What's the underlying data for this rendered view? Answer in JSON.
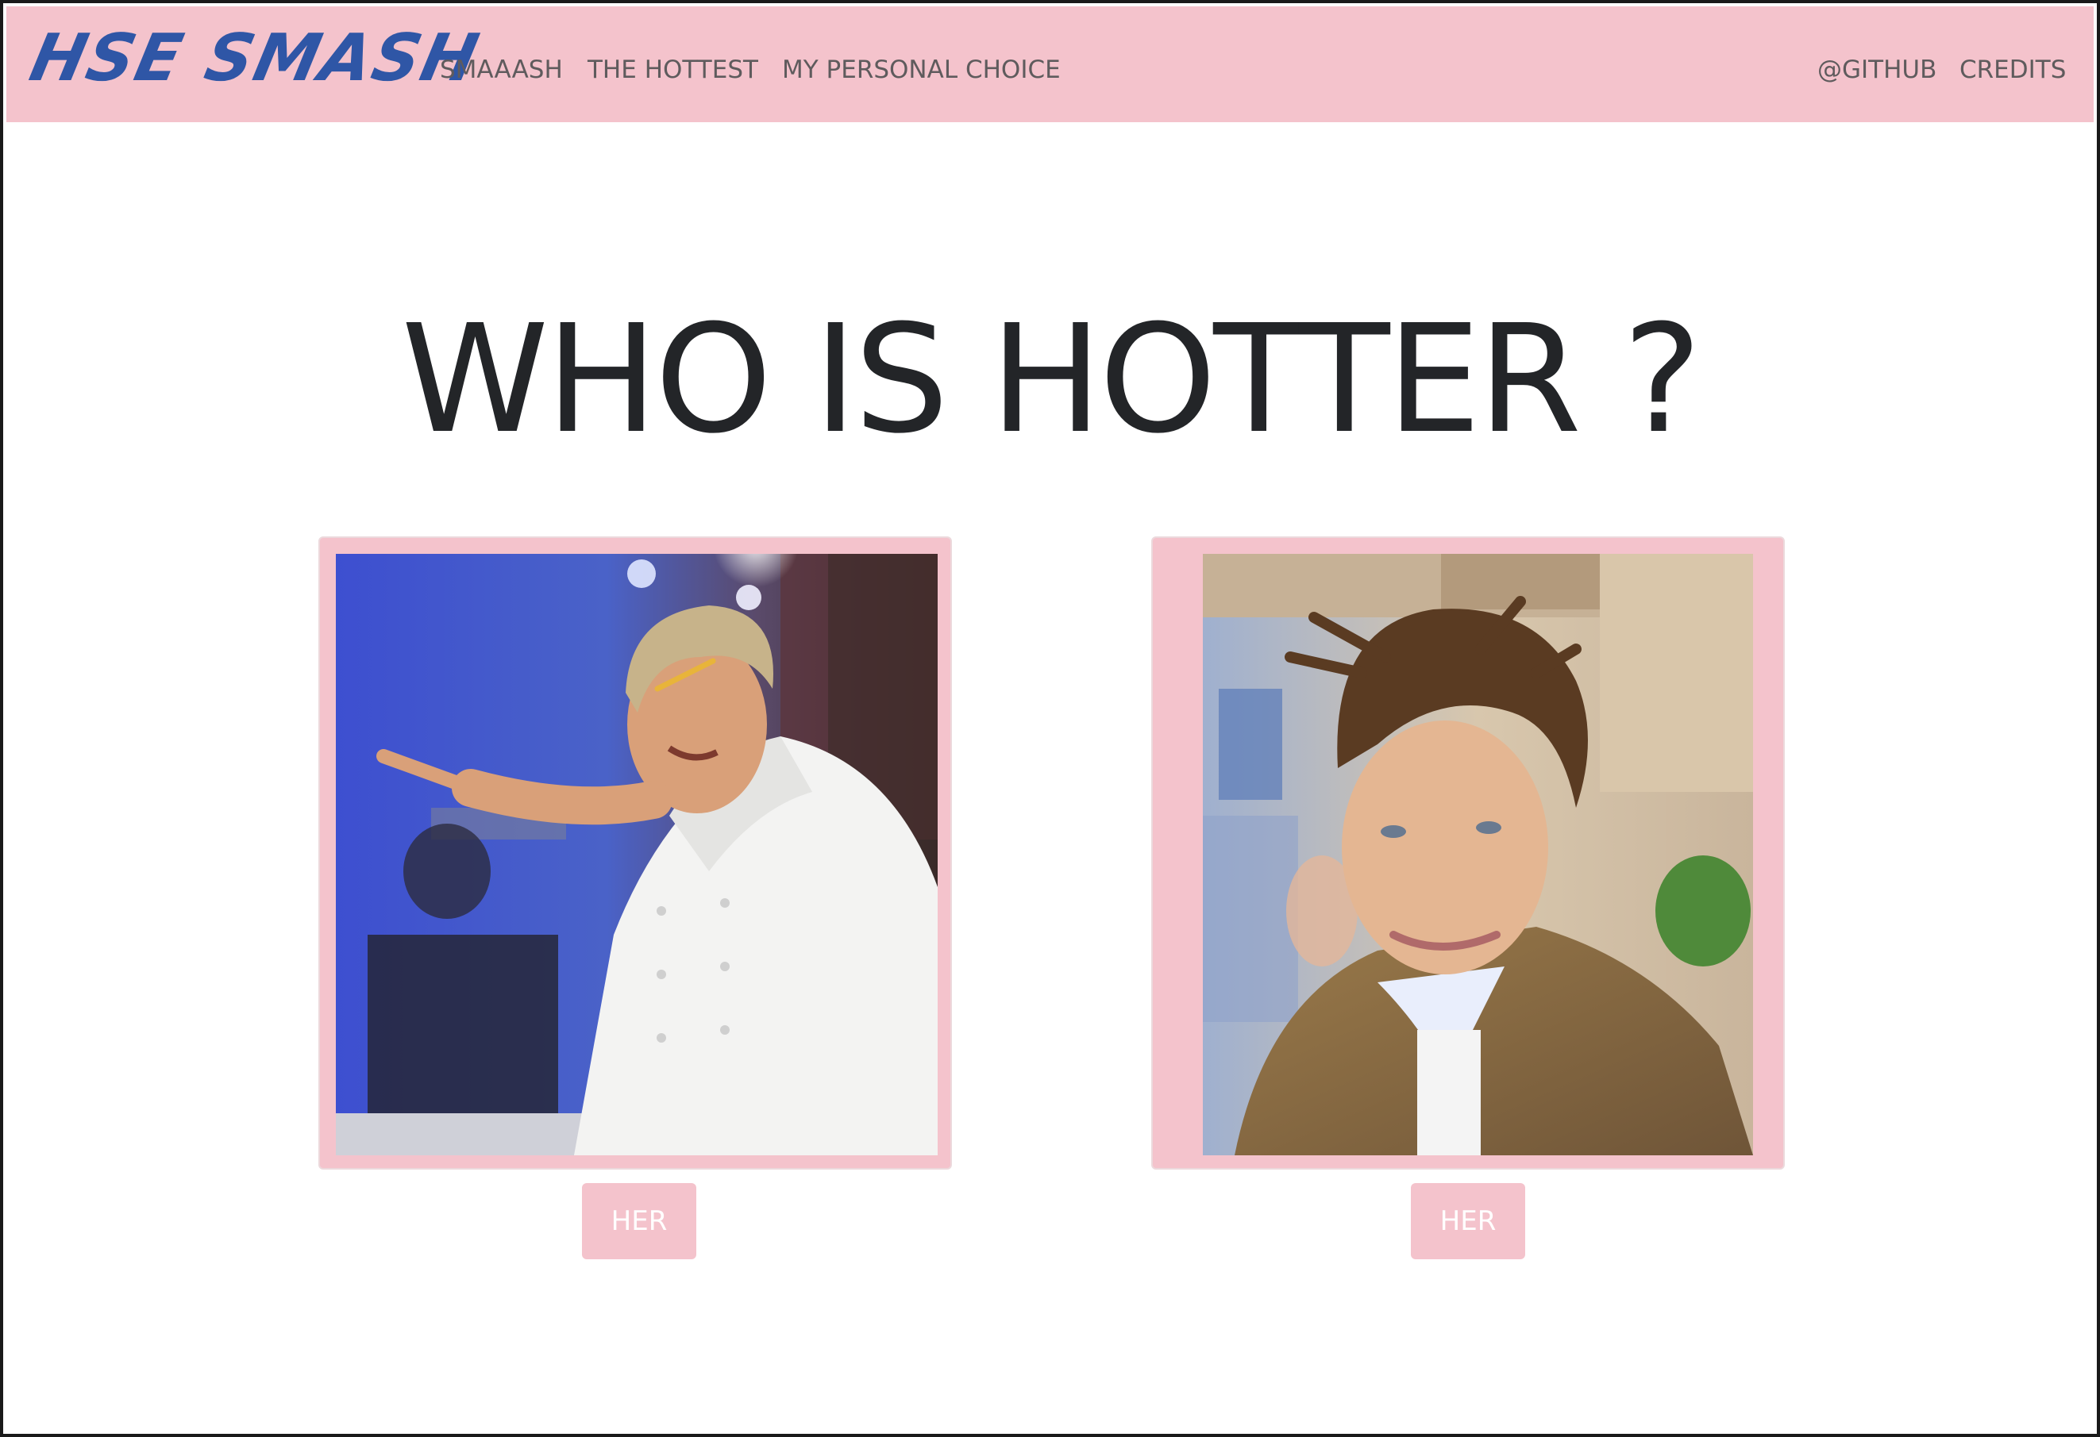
{
  "navbar": {
    "brand": "HSE SMASH",
    "links": [
      {
        "label": "SMAAASH"
      },
      {
        "label": "THE HOTTEST"
      },
      {
        "label": "MY PERSONAL CHOICE"
      }
    ],
    "right_links": [
      {
        "label": "@GITHUB"
      },
      {
        "label": "CREDITS"
      }
    ]
  },
  "main": {
    "title": "WHO IS HOTTER ?",
    "choices": [
      {
        "button_label": "HER"
      },
      {
        "button_label": "HER"
      }
    ]
  },
  "colors": {
    "accent_pink": "#f4c3cc",
    "brand_blue": "#2f56a6",
    "nav_text": "#5f5b5d"
  }
}
